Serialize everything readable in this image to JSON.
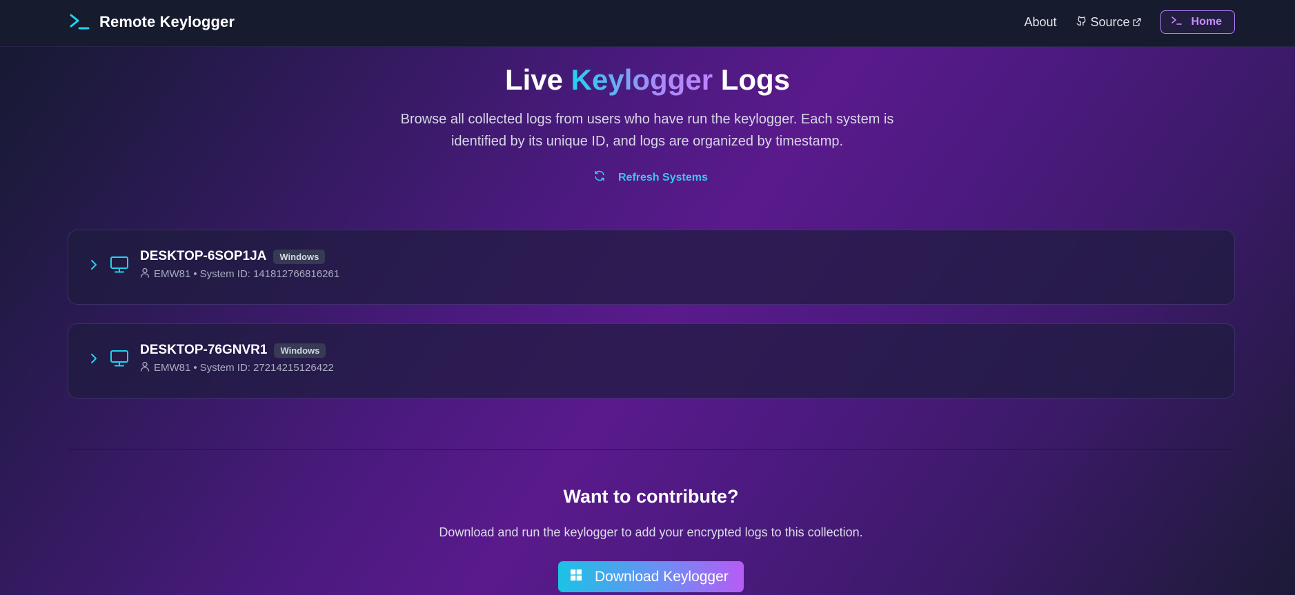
{
  "header": {
    "brand_title": "Remote Keylogger",
    "nav": {
      "about": "About",
      "source": "Source",
      "home": "Home"
    }
  },
  "hero": {
    "title_part1": "Live",
    "title_accent": "Keylogger",
    "title_part2": "Logs",
    "subtitle": "Browse all collected logs from users who have run the keylogger. Each system is identified by its unique ID, and logs are organized by timestamp.",
    "refresh_label": "Refresh Systems"
  },
  "systems": [
    {
      "name": "DESKTOP-6SOP1JA",
      "os": "Windows",
      "user": "EMW81",
      "separator": "•",
      "system_id_label": "System ID:",
      "system_id": "141812766816261"
    },
    {
      "name": "DESKTOP-76GNVR1",
      "os": "Windows",
      "user": "EMW81",
      "separator": "•",
      "system_id_label": "System ID:",
      "system_id": "27214215126422"
    }
  ],
  "contribute": {
    "title": "Want to contribute?",
    "subtitle": "Download and run the keylogger to add your encrypted logs to this collection.",
    "download_label": "Download Keylogger"
  },
  "colors": {
    "accent_cyan": "#22d3ee",
    "accent_purple": "#c084fc",
    "nav_bg": "#161b2d"
  },
  "icons": {
    "brand": "terminal-prompt-icon",
    "source": "github-icon",
    "external": "external-link-icon",
    "home": "terminal-prompt-icon",
    "refresh": "refresh-icon",
    "expand": "chevron-right-icon",
    "system": "monitor-icon",
    "user": "user-icon",
    "download": "windows-icon"
  }
}
